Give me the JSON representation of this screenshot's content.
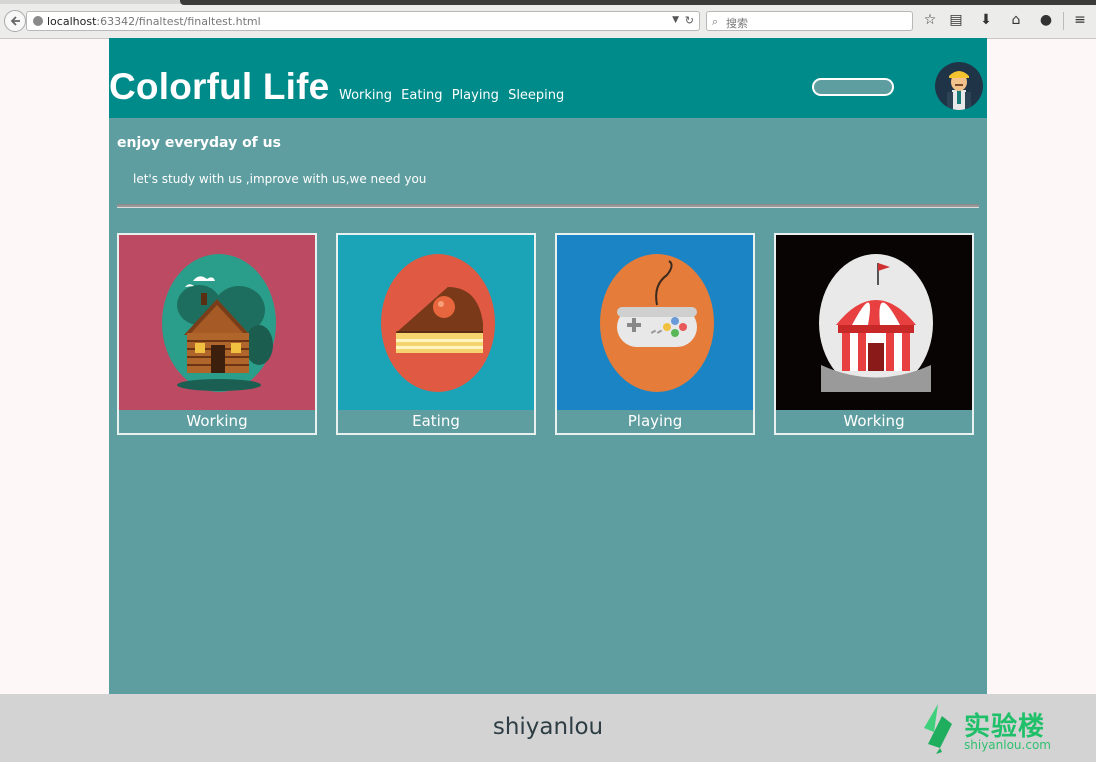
{
  "browser": {
    "url_host": "localhost",
    "url_rest": ":63342/finaltest/finaltest.html",
    "search_placeholder": "搜索"
  },
  "header": {
    "title": "Colorful Life",
    "nav": [
      "Working",
      "Eating",
      "Playing",
      "Sleeping"
    ]
  },
  "intro": {
    "tagline": "enjoy everyday of us",
    "subtext": "let's study with us ,improve with us,we need you"
  },
  "cards": [
    {
      "label": "Working",
      "bg": "#bc4a63",
      "icon": "log-cabin-icon"
    },
    {
      "label": "Eating",
      "bg": "#1ba3b8",
      "icon": "cake-slice-icon"
    },
    {
      "label": "Playing",
      "bg": "#1b84c4",
      "icon": "game-controller-icon"
    },
    {
      "label": "Working",
      "bg": "#080404",
      "icon": "circus-tent-icon"
    }
  ],
  "footer": {
    "text": "shiyanlou",
    "brand_cn": "实验楼",
    "brand_domain": "shiyanlou.com"
  },
  "colors": {
    "header": "#008b8b",
    "page": "#5f9ea0",
    "footer": "#d3d3d3"
  }
}
